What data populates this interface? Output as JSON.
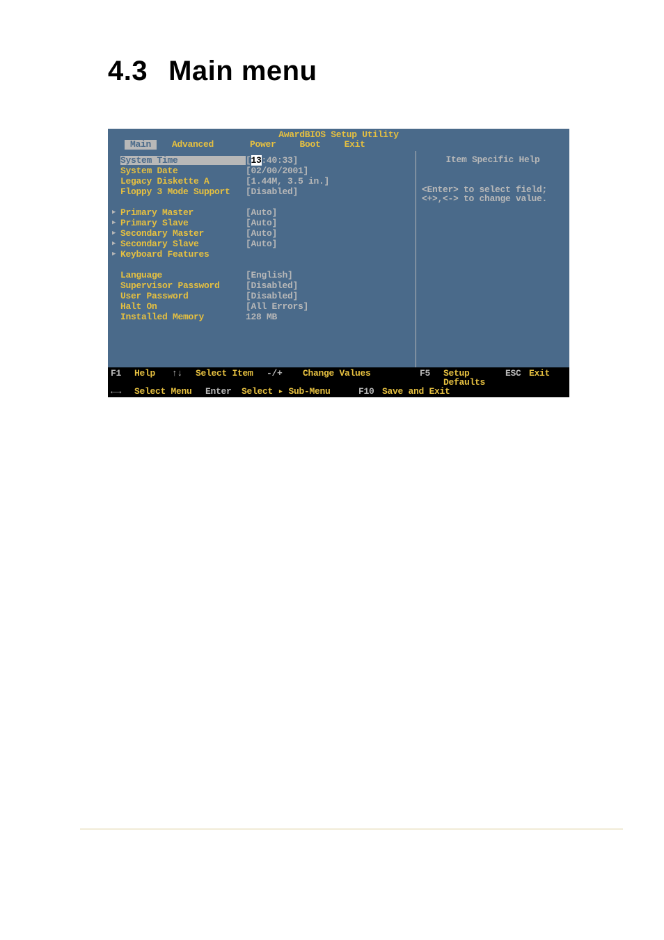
{
  "heading": {
    "number": "4.3",
    "title": "Main menu"
  },
  "bios": {
    "title": "AwardBIOS Setup Utility",
    "tabs": {
      "main": "Main",
      "advanced": "Advanced",
      "power": "Power",
      "boot": "Boot",
      "exit": "Exit"
    },
    "items": {
      "system_time": {
        "label": "System Time",
        "value_prefix": "[",
        "cursor": "13",
        "value_rest": ":40:33]"
      },
      "system_date": {
        "label": "System Date",
        "value": "[02/00/2001]"
      },
      "legacy_diskette": {
        "label": "Legacy Diskette A",
        "value": "[1.44M, 3.5 in.]"
      },
      "floppy3": {
        "label": "Floppy 3 Mode Support",
        "value": "[Disabled]"
      },
      "primary_master": {
        "label": "Primary Master",
        "value": "[Auto]"
      },
      "primary_slave": {
        "label": "Primary Slave",
        "value": "[Auto]"
      },
      "secondary_master": {
        "label": "Secondary Master",
        "value": "[Auto]"
      },
      "secondary_slave": {
        "label": "Secondary Slave",
        "value": "[Auto]"
      },
      "keyboard": {
        "label": "Keyboard Features",
        "value": ""
      },
      "language": {
        "label": "Language",
        "value": "[English]"
      },
      "supervisor_pw": {
        "label": "Supervisor Password",
        "value": "[Disabled]"
      },
      "user_pw": {
        "label": "User Password",
        "value": "[Disabled]"
      },
      "halt_on": {
        "label": "Halt On",
        "value": "[All Errors]"
      },
      "installed_mem": {
        "label": "Installed Memory",
        "value": "128 MB"
      }
    },
    "help": {
      "title": "Item Specific Help",
      "line1": "<Enter> to select field;",
      "line2": "<+>,<-> to change value."
    },
    "footer": {
      "f1": "F1",
      "f1_label": "Help",
      "updown": "↑↓",
      "updown_label": "Select Item",
      "plusminus": "-/+",
      "plusminus_label": "Change Values",
      "f5": "F5",
      "f5_label": "Setup Defaults",
      "esc": "ESC",
      "esc_label": "Exit",
      "leftright": "←→",
      "leftright_label": "Select Menu",
      "enter": "Enter",
      "enter_label": "Select ▸ Sub-Menu",
      "f10": "F10",
      "f10_label": "Save and Exit"
    }
  }
}
